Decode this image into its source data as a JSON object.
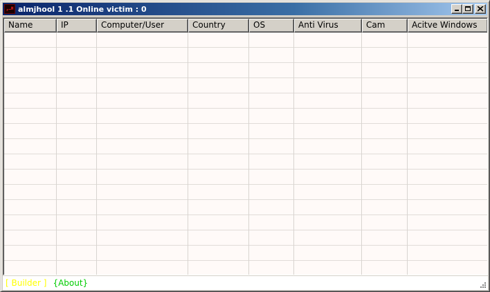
{
  "window": {
    "icon_text": "ٍ.ـH",
    "title": "almjhool 1 .1 Online victim : 0"
  },
  "list": {
    "columns": [
      "Name",
      "IP",
      "Computer/User",
      "Country",
      "OS",
      "Anti Virus",
      "Cam",
      "Acitve Windows"
    ],
    "rows": []
  },
  "statusbar": {
    "builder_label": "[ Builder ]",
    "about_label": "{About}",
    "builder_color": "#ffff00",
    "about_color": "#00cc00"
  }
}
